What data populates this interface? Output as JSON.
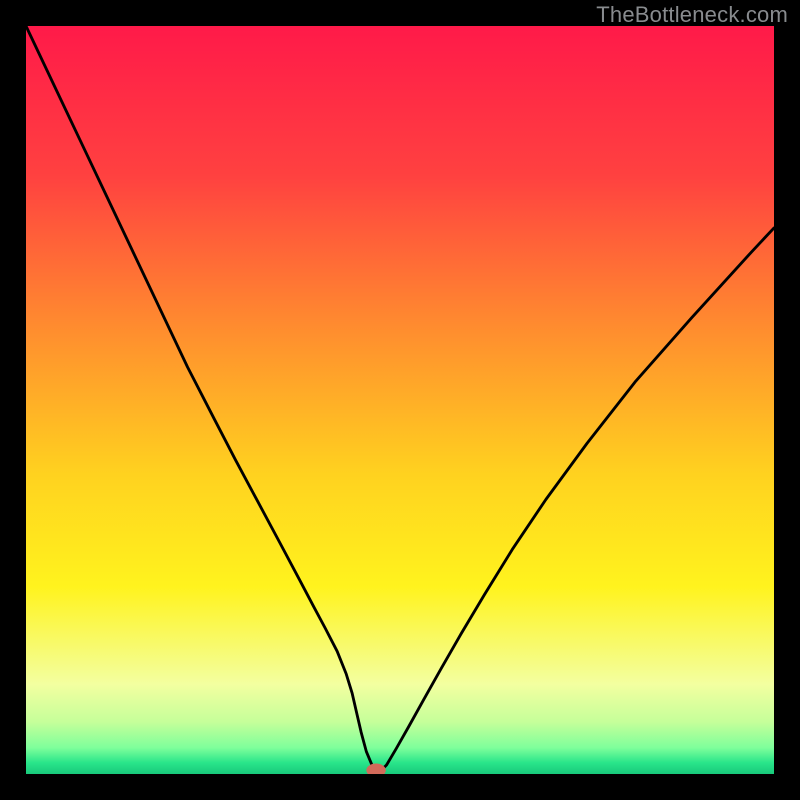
{
  "watermark": "TheBottleneck.com",
  "chart_data": {
    "type": "line",
    "title": "",
    "xlabel": "",
    "ylabel": "",
    "xlim": [
      0,
      100
    ],
    "ylim": [
      0,
      100
    ],
    "grid": false,
    "gradient_stops": [
      {
        "offset": 0.0,
        "color": "#ff1a49"
      },
      {
        "offset": 0.2,
        "color": "#ff4140"
      },
      {
        "offset": 0.4,
        "color": "#ff8b2f"
      },
      {
        "offset": 0.6,
        "color": "#ffd21f"
      },
      {
        "offset": 0.75,
        "color": "#fff31e"
      },
      {
        "offset": 0.88,
        "color": "#f3ffa0"
      },
      {
        "offset": 0.93,
        "color": "#c6ff9a"
      },
      {
        "offset": 0.965,
        "color": "#7eff9b"
      },
      {
        "offset": 0.985,
        "color": "#29e58a"
      },
      {
        "offset": 1.0,
        "color": "#18c97b"
      }
    ],
    "curve": {
      "x": [
        0.0,
        3.6,
        7.2,
        10.8,
        14.4,
        18.0,
        21.6,
        25.2,
        28.0,
        31.0,
        34.0,
        36.5,
        38.5,
        40.0,
        41.6,
        42.8,
        43.6,
        44.2,
        44.8,
        45.5,
        46.5,
        47.2,
        48.2,
        49.5,
        51.2,
        53.2,
        55.5,
        58.2,
        61.3,
        65.0,
        69.5,
        75.0,
        81.5,
        89.0,
        97.0,
        100.0
      ],
      "y": [
        100.0,
        92.4,
        84.8,
        77.2,
        69.6,
        62.0,
        54.4,
        47.4,
        42.0,
        36.4,
        30.8,
        26.1,
        22.3,
        19.5,
        16.4,
        13.4,
        10.8,
        8.2,
        5.6,
        3.0,
        0.6,
        0.2,
        1.2,
        3.4,
        6.4,
        10.0,
        14.1,
        18.8,
        24.0,
        30.0,
        36.7,
        44.2,
        52.5,
        61.0,
        69.8,
        73.0
      ]
    },
    "marker": {
      "x": 46.8,
      "y": 0.5,
      "rx": 1.3,
      "ry": 0.9,
      "color": "#d26a5a"
    }
  }
}
